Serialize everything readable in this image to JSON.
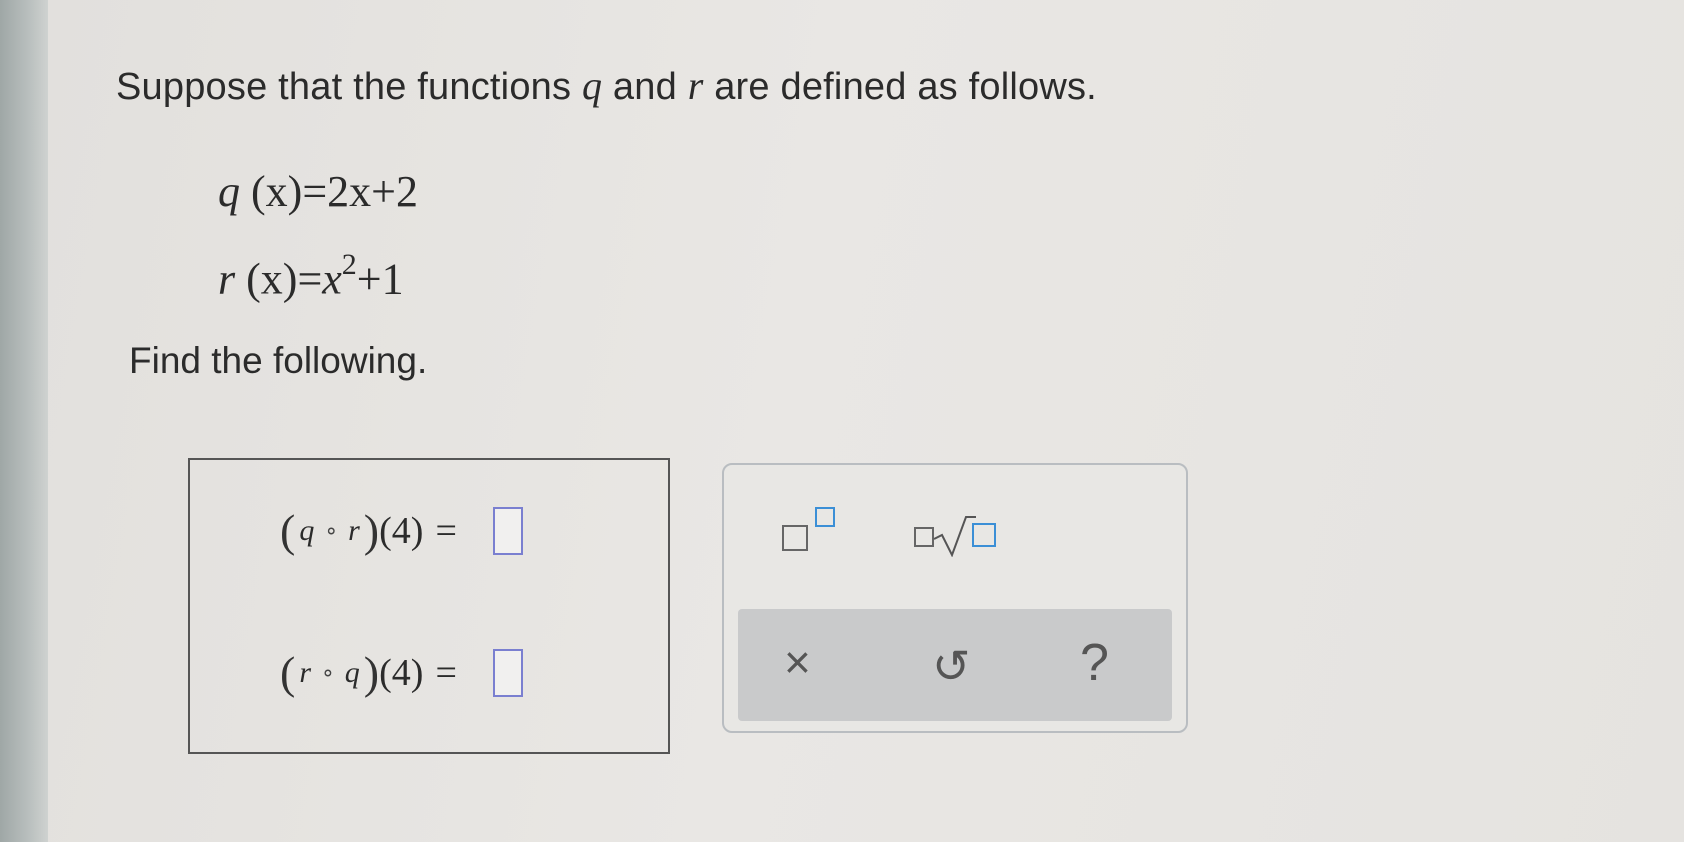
{
  "problem": {
    "intro_before_q": "Suppose that the functions ",
    "var_q": "q",
    "intro_and": " and ",
    "var_r": "r",
    "intro_after": " are defined as follows.",
    "q_def": {
      "name": "q",
      "arg": "(x)",
      "rhs": "=2x+2"
    },
    "r_def": {
      "name": "r",
      "arg": "(x)",
      "eq": "=",
      "base": "x",
      "exponent": "2",
      "rest": "+1"
    },
    "prompt": "Find the following."
  },
  "answers": [
    {
      "left_paren": "(",
      "f1": "q",
      "circ": "∘",
      "f2": "r",
      "right_paren": ")",
      "arg": "(4)",
      "eq": "=",
      "value": ""
    },
    {
      "left_paren": "(",
      "f1": "r",
      "circ": "∘",
      "f2": "q",
      "right_paren": ")",
      "arg": "(4)",
      "eq": "=",
      "value": ""
    }
  ],
  "toolbar": {
    "tools": [
      {
        "icon": "superscript-template-icon"
      },
      {
        "icon": "nth-root-template-icon"
      }
    ],
    "actions": {
      "clear": "×",
      "undo": "↺",
      "help": "?"
    },
    "accent_color": "#3b8fd6"
  }
}
